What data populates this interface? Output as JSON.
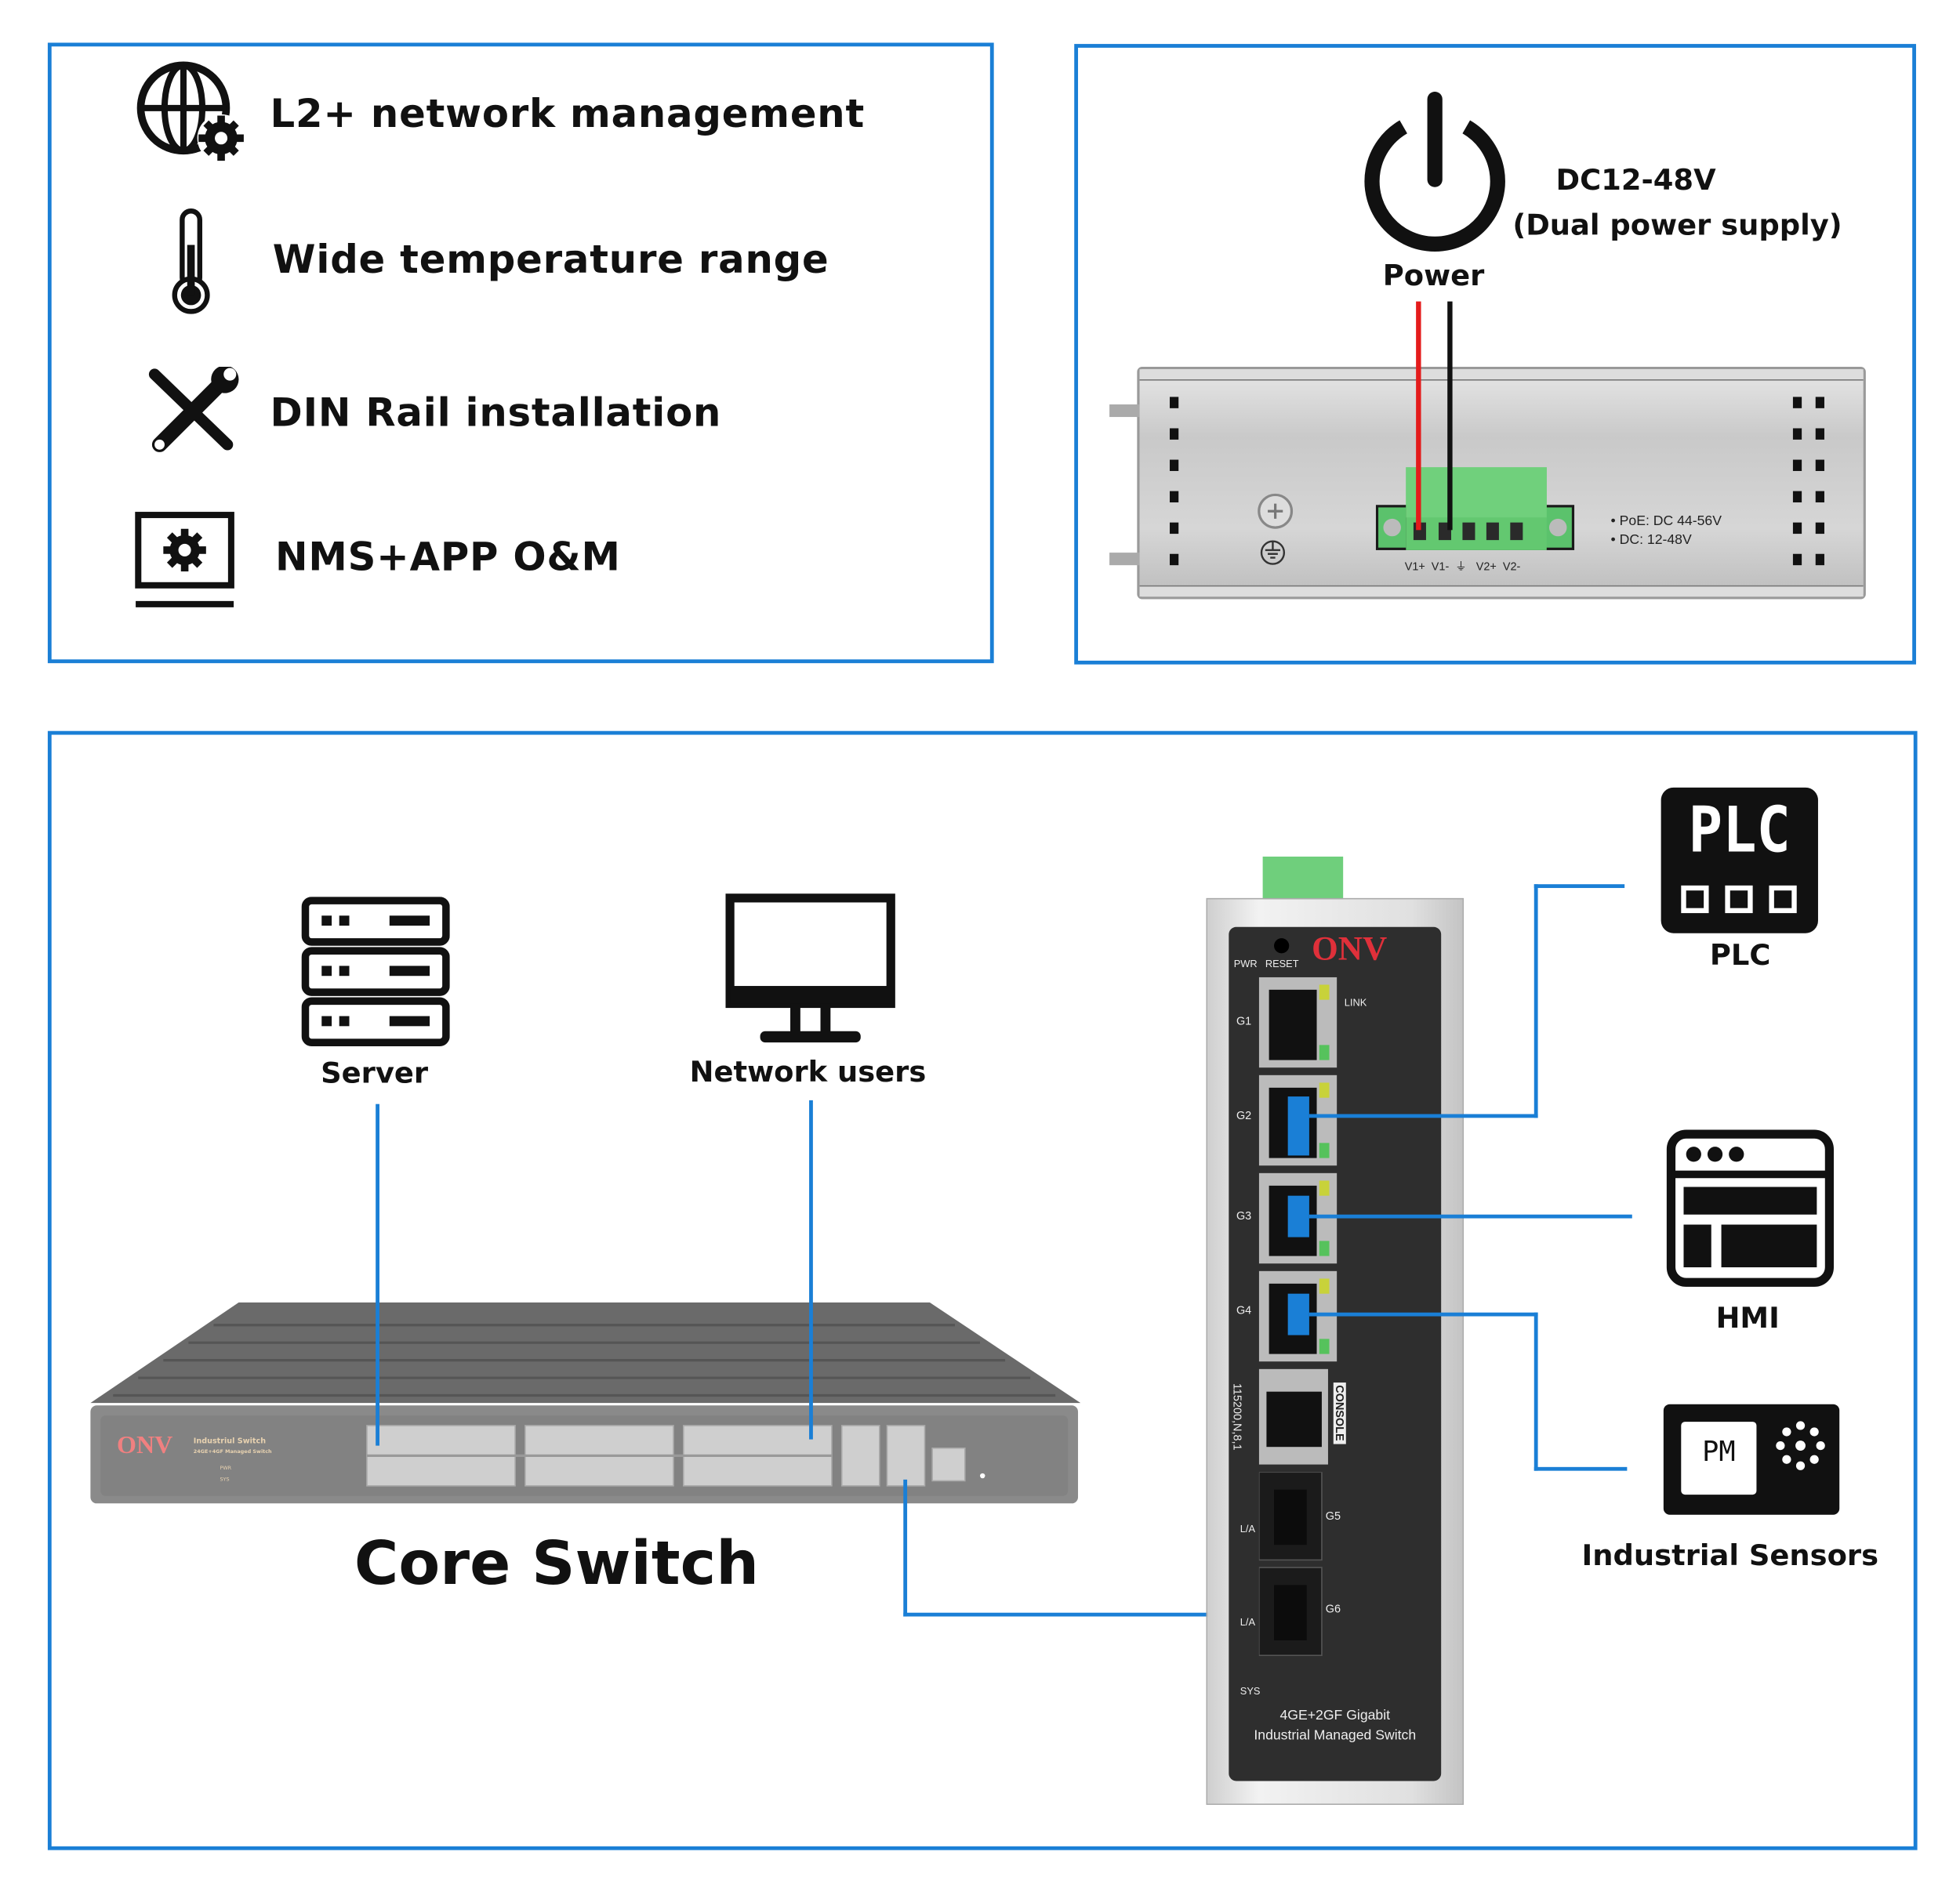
{
  "features": {
    "items": [
      {
        "icon": "globe-gear-icon",
        "label": "L2+ network management"
      },
      {
        "icon": "thermometer-icon",
        "label": "Wide temperature range"
      },
      {
        "icon": "tools-icon",
        "label": "DIN Rail installation"
      },
      {
        "icon": "laptop-gear-icon",
        "label": "NMS+APP O&M"
      }
    ]
  },
  "power": {
    "icon": "power-icon",
    "label": "Power",
    "voltage": "DC12-48V",
    "supply": "(Dual power supply)",
    "terminal_labels": [
      "V1+",
      "V1-",
      "V2+",
      "V2-"
    ],
    "spec_poe": "PoE: DC 44-56V",
    "spec_dc": "DC: 12-48V",
    "wire_colors": [
      "#e41b1b",
      "#111111"
    ]
  },
  "topology": {
    "server_label": "Server",
    "users_label": "Network users",
    "core_switch_label": "Core Switch",
    "core_switch": {
      "brand": "ONV",
      "title": "Industriul Switch",
      "model": "24GE+4GF Managed Switch",
      "leds": [
        "PWR",
        "SYS"
      ]
    },
    "device": {
      "brand": "ONV",
      "top_labels": [
        "PWR",
        "RESET"
      ],
      "link_label": "LINK",
      "ports": [
        "G1",
        "G2",
        "G3",
        "G4"
      ],
      "console_label": "CONSOLE",
      "baud_label": "115200,N,8,1",
      "sfp_ports": [
        "G5",
        "G6"
      ],
      "la_label": "L/A",
      "sys_label": "SYS",
      "model_line1": "4GE+2GF Gigabit",
      "model_line2": "Industrial Managed Switch"
    },
    "plc_label": "PLC",
    "plc_icon_text": "PLC",
    "hmi_label": "HMI",
    "sensors_label": "Industrial Sensors",
    "sensor_icon_text": "PM",
    "link_color": "#1a7fd6",
    "brand_color": "#e0303a"
  }
}
